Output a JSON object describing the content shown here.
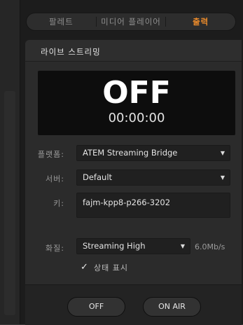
{
  "tabs": [
    {
      "label": "팔레트",
      "active": false
    },
    {
      "label": "미디어 플레이어",
      "active": false
    },
    {
      "label": "출력",
      "active": true
    }
  ],
  "section": {
    "title": "라이브 스트리밍"
  },
  "status": {
    "text": "OFF",
    "timer": "00:00:00"
  },
  "form": {
    "platform_label": "플랫폼:",
    "platform_value": "ATEM Streaming Bridge",
    "server_label": "서버:",
    "server_value": "Default",
    "key_label": "키:",
    "key_value": "fajm-kpp8-p266-3202",
    "quality_label": "화질:",
    "quality_value": "Streaming High",
    "bitrate": "6.0Mb/s",
    "status_checkbox_label": "상태 표시",
    "status_checkbox_checked": true
  },
  "buttons": {
    "off_label": "OFF",
    "on_air_label": "ON AIR"
  },
  "colors": {
    "accent": "#e8892b",
    "panel": "#2b2b2b",
    "display": "#0d0d0d"
  }
}
